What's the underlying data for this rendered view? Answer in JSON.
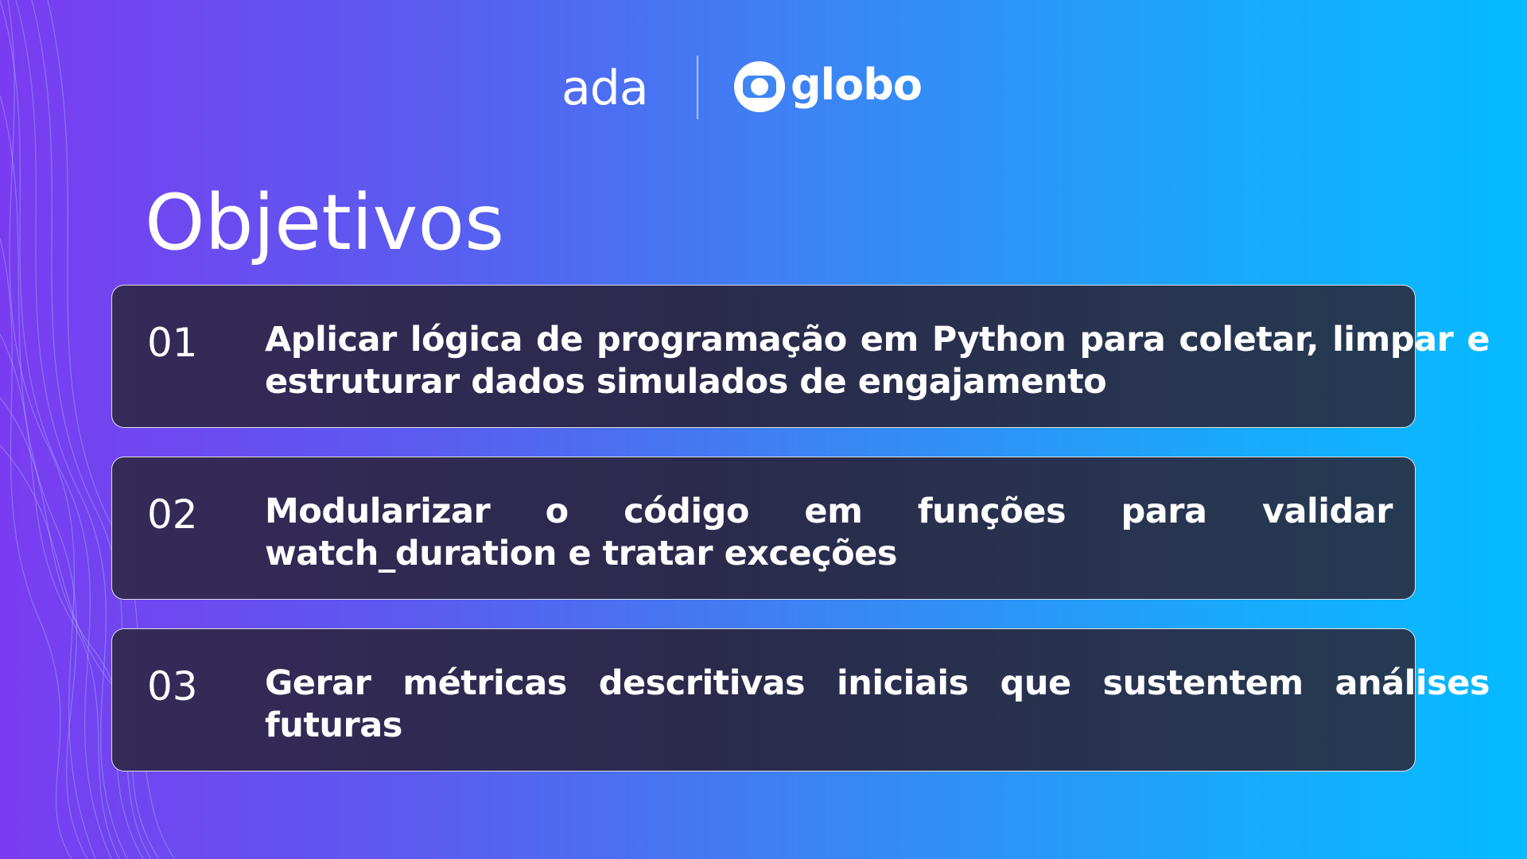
{
  "header": {
    "logo_ada": "ada",
    "logo_globo": "globo"
  },
  "page": {
    "title": "Objetivos"
  },
  "objectives": [
    {
      "number": "01",
      "text": "Aplicar lógica de programação em Python para coletar, limpar e estruturar dados simulados de engajamento"
    },
    {
      "number": "02",
      "text": "Modularizar o código em funções para validar watch_duration e tratar exceções"
    },
    {
      "number": "03",
      "text": "Gerar métricas descritivas iniciais que sustentem análises futuras"
    }
  ],
  "colors": {
    "gradient_start": "#7a3cf0",
    "gradient_end": "#05bbff",
    "card_background": "#2b2a4c",
    "card_border": "#ffffff",
    "text": "#ffffff"
  }
}
